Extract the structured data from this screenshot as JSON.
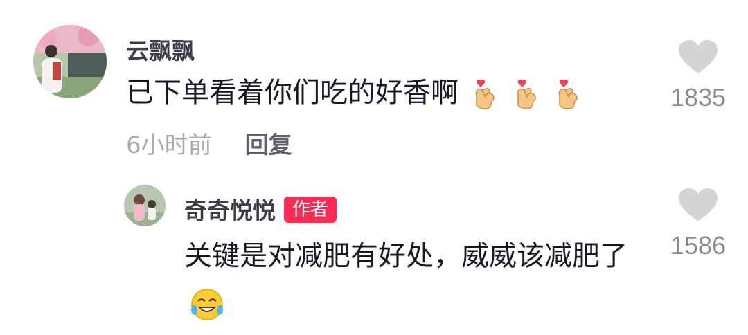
{
  "comment": {
    "username": "云飘飘",
    "text": "已下单看着你们吃的好香啊",
    "emojis": [
      "finger-heart-emoji",
      "finger-heart-emoji",
      "finger-heart-emoji"
    ],
    "time": "6小时前",
    "reply_label": "回复",
    "like_count": "1835",
    "like_icon": "heart-icon"
  },
  "reply": {
    "username": "奇奇悦悦",
    "badge": "作者",
    "text": "关键是对减肥有好处，威威该减肥了",
    "emoji": "tears-of-joy-emoji",
    "like_count": "1586",
    "like_icon": "heart-icon"
  },
  "colors": {
    "badge": "#fe2c55",
    "heart": "#d4d4d6",
    "time": "#a8aaaf",
    "username": "#3d3f48"
  }
}
